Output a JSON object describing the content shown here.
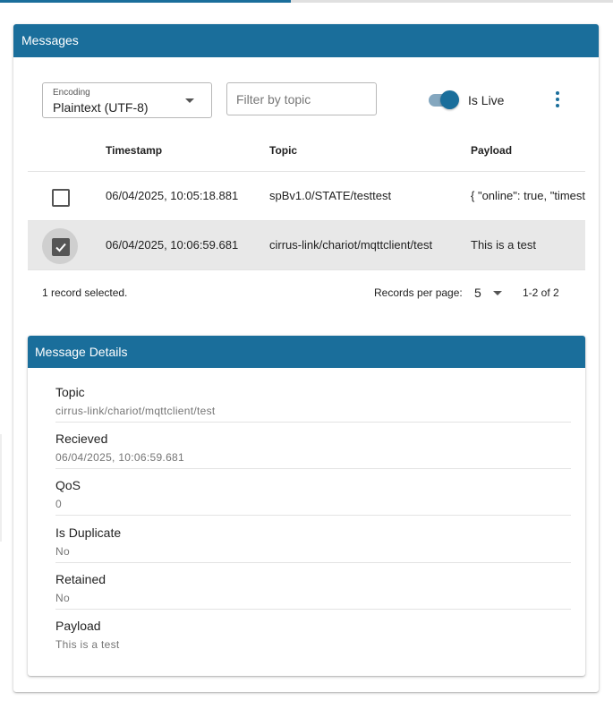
{
  "header": {
    "title": "Messages"
  },
  "controls": {
    "encoding_label": "Encoding",
    "encoding_value": "Plaintext (UTF-8)",
    "filter_placeholder": "Filter by topic",
    "filter_value": "",
    "live_label": "Is Live",
    "live_on": true
  },
  "table": {
    "columns": [
      "Timestamp",
      "Topic",
      "Payload"
    ],
    "rows": [
      {
        "timestamp": "06/04/2025, 10:05:18.881",
        "topic": "spBv1.0/STATE/testtest",
        "payload": "{ \"online\": true, \"timestamp\"",
        "selected": false
      },
      {
        "timestamp": "06/04/2025, 10:06:59.681",
        "topic": "cirrus-link/chariot/mqttclient/test",
        "payload": "This is a test",
        "selected": true
      }
    ]
  },
  "footer": {
    "selected_text": "1 record selected.",
    "rows_per_page_label": "Records per page:",
    "rows_per_page": "5",
    "range": "1-2 of 2"
  },
  "details": {
    "title": "Message Details",
    "fields": [
      {
        "label": "Topic",
        "value": "cirrus-link/chariot/mqttclient/test"
      },
      {
        "label": "Recieved",
        "value": "06/04/2025, 10:06:59.681"
      },
      {
        "label": "QoS",
        "value": "0"
      },
      {
        "label": "Is Duplicate",
        "value": "No"
      },
      {
        "label": "Retained",
        "value": "No"
      },
      {
        "label": "Payload",
        "value": "This is a test"
      }
    ]
  },
  "colors": {
    "accent": "#1a6e9b",
    "selected_row": "#e8e8e8"
  },
  "icons": {
    "checkbox_checked": "check-icon",
    "menu": "more-vert-icon",
    "dropdown": "chevron-down-icon"
  }
}
